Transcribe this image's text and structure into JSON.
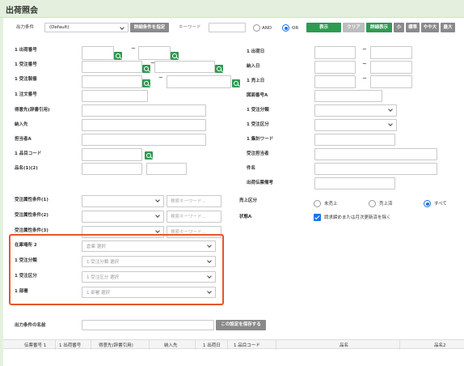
{
  "page": {
    "title": "出荷照会"
  },
  "colors": {
    "header_bg": "#e4f0dd",
    "primary_green": "#2e9a52",
    "accent_blue": "#1a73e8",
    "highlight_orange": "#e8552b"
  },
  "toolbar": {
    "output_cond_label": "出力条件",
    "output_cond_value": "(Default)",
    "detail_btn": "詳細条件を指定",
    "keyword_label": "キーワード",
    "and_label": "AND",
    "or_label": "OR",
    "display_btn": "表示",
    "clear_btn": "クリア",
    "detail_view_btn": "詳細表示",
    "size_small": "小",
    "size_std": "標準",
    "size_mid": "やや大",
    "size_max": "最大"
  },
  "left": {
    "ship_no": "1 出荷番号",
    "order_no": "1 受注番号",
    "order_ref": "1 受注製番",
    "note_no": "1 注文番号",
    "customer": "得意先(辞書引用)",
    "delivery": "納入先",
    "person": "担当者A",
    "item_code": "1 品目コード",
    "item_name": "品名(1)(2)"
  },
  "right": {
    "ship_date": "1 出荷日",
    "delivery_date": "納入日",
    "sale_date": "1 売上日",
    "drawing": "図面番号A",
    "order_class": "1 受注分類",
    "order_type": "1 受注区分",
    "agg_word": "1 集計ワード",
    "order_person": "受注担当者",
    "subject": "件名",
    "memo": "出荷伝票備考"
  },
  "attrs": {
    "cond1": "受注属性条件(1)",
    "cond2": "受注属性条件(2)",
    "cond3": "受注属性条件(3)",
    "kw_placeholder": "検索キーワード..."
  },
  "sales": {
    "label": "売上区分",
    "unsold": "未売上",
    "sold": "売上済",
    "all": "すべて",
    "status_label": "状態A",
    "exclude": "請求締めまたは月次更新済を除く"
  },
  "highlighted": {
    "location_label": "在庫場所 2",
    "location_ph": "倉庫 選択",
    "class_label": "1 受注分類",
    "class_ph": "1 受注分類 選択",
    "type_label": "1 受注区分",
    "type_ph": "1 受注区分 選択",
    "dept_label": "1 部署",
    "dept_ph": "1 部署 選択"
  },
  "save": {
    "label": "出力条件の名前",
    "btn": "この設定を保存する"
  },
  "table": {
    "columns": [
      "伝票番号 1",
      "1 出荷番号",
      "得意先(辞書引用)",
      "納入先",
      "1 出荷日",
      "1 品目コード",
      "品名",
      "品名2"
    ]
  }
}
